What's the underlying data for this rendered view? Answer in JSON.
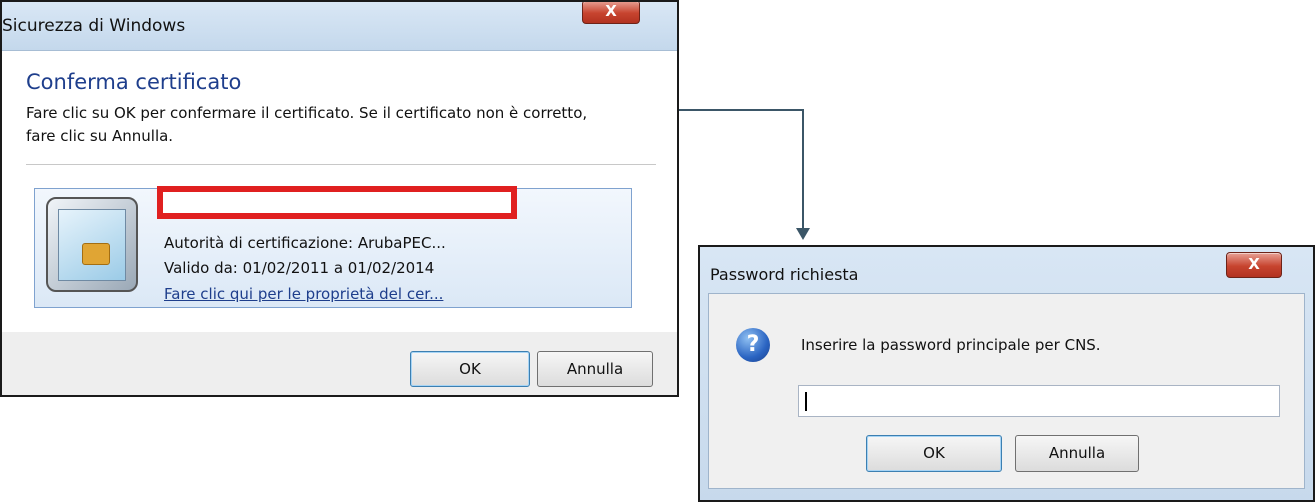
{
  "dialog1": {
    "title": "Sicurezza di Windows",
    "close_glyph": "X",
    "heading": "Conferma certificato",
    "description_line1": "Fare clic su OK per confermare il certificato. Se il certificato non è corretto,",
    "description_line2": "fare clic su Annulla.",
    "certificate": {
      "icon": "smart-card-icon",
      "name": "",
      "issuer": "Autorità di certificazione: ArubaPEC...",
      "validity": "Valido da: 01/02/2011 a 01/02/2014",
      "properties_link": "Fare clic qui per le proprietà del cer..."
    },
    "ok_label": "OK",
    "cancel_label": "Annulla"
  },
  "dialog2": {
    "title": "Password richiesta",
    "close_glyph": "X",
    "icon": "question-icon",
    "icon_glyph": "?",
    "prompt": "Inserire la password principale per CNS.",
    "password_value": "",
    "ok_label": "OK",
    "cancel_label": "Annulla"
  },
  "colors": {
    "heading": "#1e3e8c",
    "redaction_box": "#e02020",
    "connector": "#3b5667",
    "close_button": "#c7442f"
  }
}
